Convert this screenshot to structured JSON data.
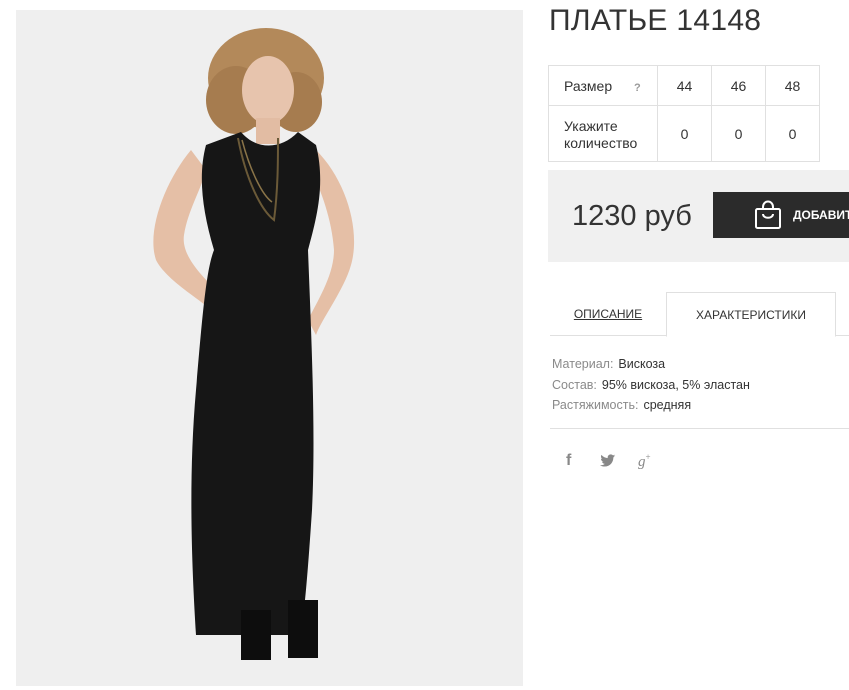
{
  "product": {
    "title": "ПЛАТЬЕ 14148",
    "image_alt_icon": "product-photo"
  },
  "size_table": {
    "size_label": "Размер",
    "help_label": "?",
    "qty_label_line1": "Укажите",
    "qty_label_line2": "количество",
    "sizes": [
      "44",
      "46",
      "48"
    ],
    "quantities": [
      "0",
      "0",
      "0"
    ]
  },
  "purchase": {
    "price": "1230 руб",
    "add_button_label": "ДОБАВИТЬ"
  },
  "tabs": {
    "description": "ОПИСАНИЕ",
    "characteristics": "ХАРАКТЕРИСТИКИ"
  },
  "specs": [
    {
      "key": "Материал:",
      "value": "Вискоза"
    },
    {
      "key": "Состав:",
      "value": "95% вискоза, 5% эластан"
    },
    {
      "key": "Растяжимость:",
      "value": "средняя"
    }
  ],
  "social": {
    "facebook": "f",
    "twitter": "twitter-icon",
    "google": "g",
    "google_sup": "+"
  }
}
